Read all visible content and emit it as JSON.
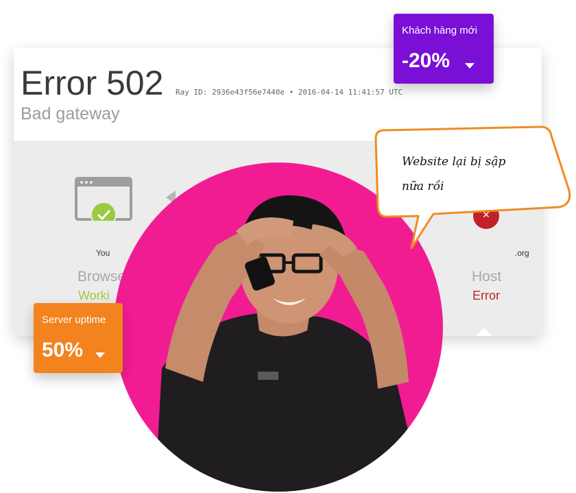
{
  "error": {
    "title": "Error 502",
    "ray_id": "Ray ID: 2936e43f56e7440e • 2016-04-14 11:41:57 UTC",
    "subtitle": "Bad gateway"
  },
  "nodes": {
    "browser": {
      "name": "You",
      "role": "Browse",
      "status": "Worki"
    },
    "host": {
      "name": ".org",
      "role": "Host",
      "status": "Error"
    }
  },
  "kpis": {
    "new_customers": {
      "label": "Khách hàng mới",
      "value": "-20%"
    },
    "server_uptime": {
      "label": "Server uptime",
      "value": "50%"
    }
  },
  "speech_bubble": {
    "line1": "Website lại bị sập",
    "line2": "nữa rồi"
  },
  "colors": {
    "accent_purple": "#7a0fd6",
    "accent_orange": "#f2831f",
    "circle_pink": "#f21c92",
    "status_working": "#9bca3e",
    "status_error": "#bd2426"
  }
}
